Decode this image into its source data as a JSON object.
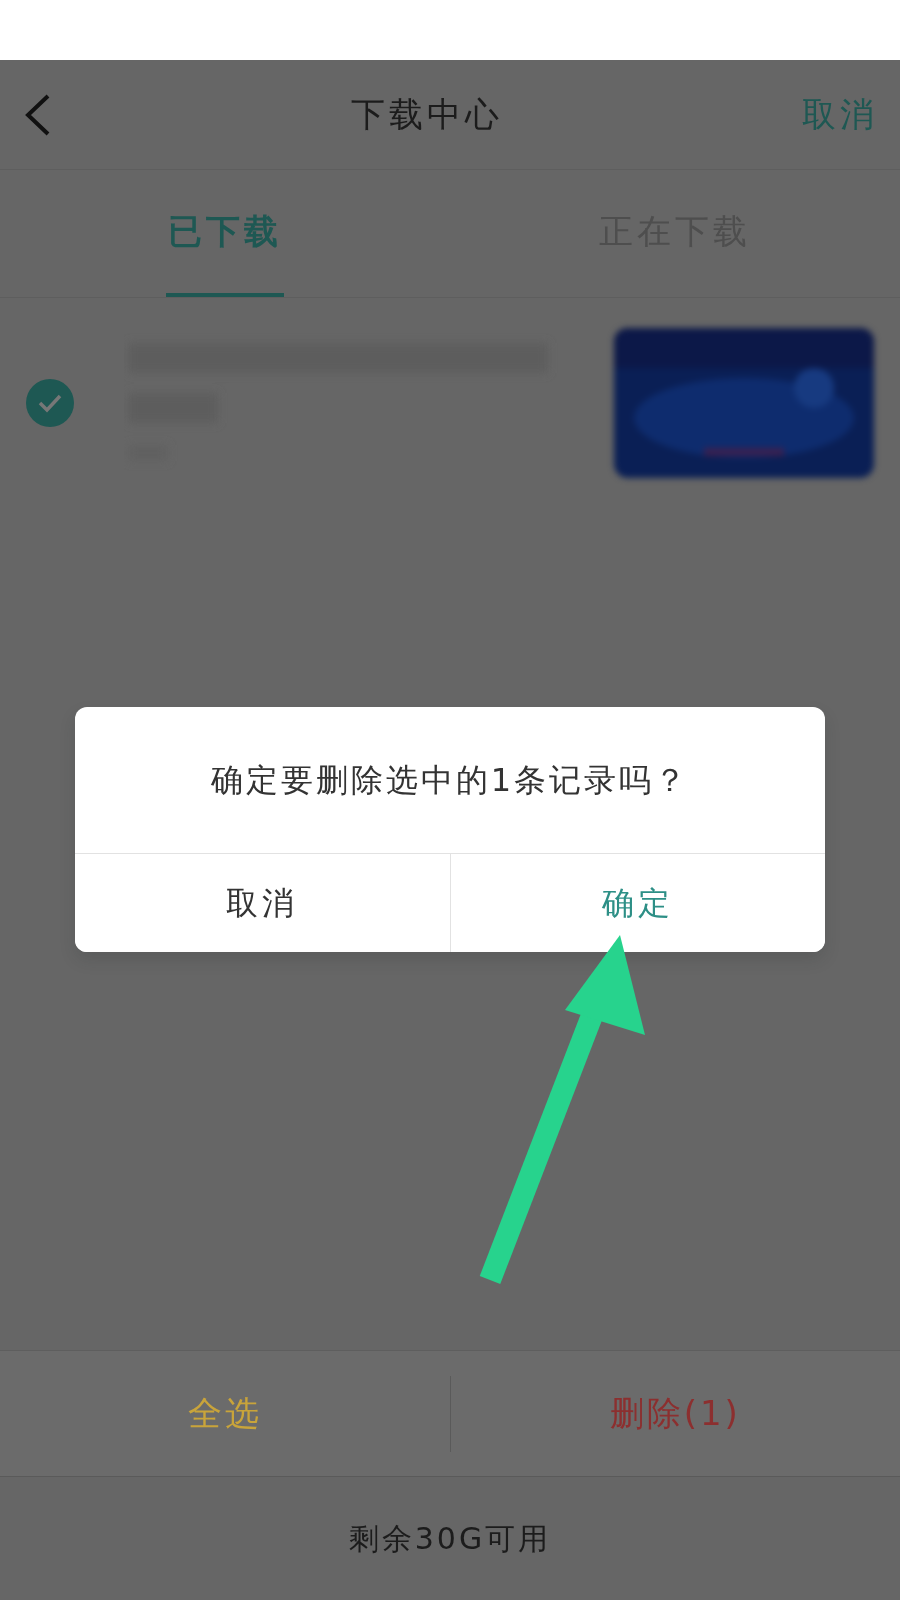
{
  "header": {
    "title": "下载中心",
    "action": "取消"
  },
  "tabs": [
    {
      "label": "已下载",
      "selected": true
    },
    {
      "label": "正在下载",
      "selected": false
    }
  ],
  "downloads": [
    {
      "checked": true
    }
  ],
  "dialog": {
    "message": "确定要删除选中的1条记录吗？",
    "buttons": [
      {
        "label": "取消",
        "primary": false
      },
      {
        "label": "确定",
        "primary": true
      }
    ]
  },
  "toolbar": {
    "select_all": "全选",
    "delete": "删除(1)"
  },
  "storage": "剩余30G可用"
}
